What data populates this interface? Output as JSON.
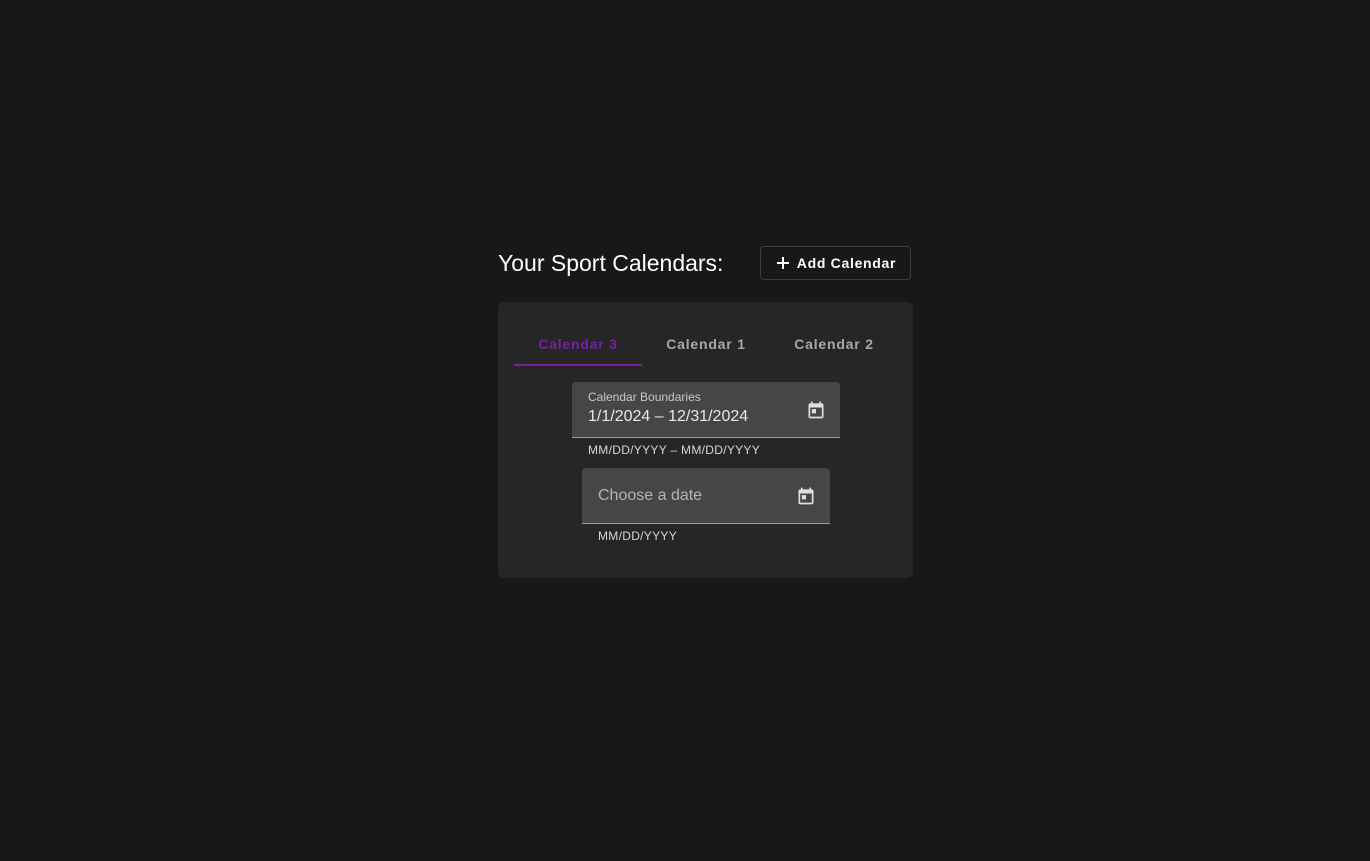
{
  "header": {
    "title": "Your Sport Calendars:",
    "add_button_label": "Add Calendar",
    "add_button_icon": "plus-icon"
  },
  "tabs": [
    {
      "label": "Calendar 3",
      "active": true
    },
    {
      "label": "Calendar 1",
      "active": false
    },
    {
      "label": "Calendar 2",
      "active": false
    }
  ],
  "range_field": {
    "label": "Calendar Boundaries",
    "value": "1/1/2024 – 12/31/2024",
    "hint": "MM/DD/YYYY – MM/DD/YYYY",
    "icon": "calendar-icon"
  },
  "date_field": {
    "placeholder": "Choose a date",
    "hint": "MM/DD/YYYY",
    "icon": "calendar-icon"
  },
  "colors": {
    "background": "#181818",
    "card": "#262626",
    "accent": "#7b1fa2",
    "field": "#464646"
  }
}
